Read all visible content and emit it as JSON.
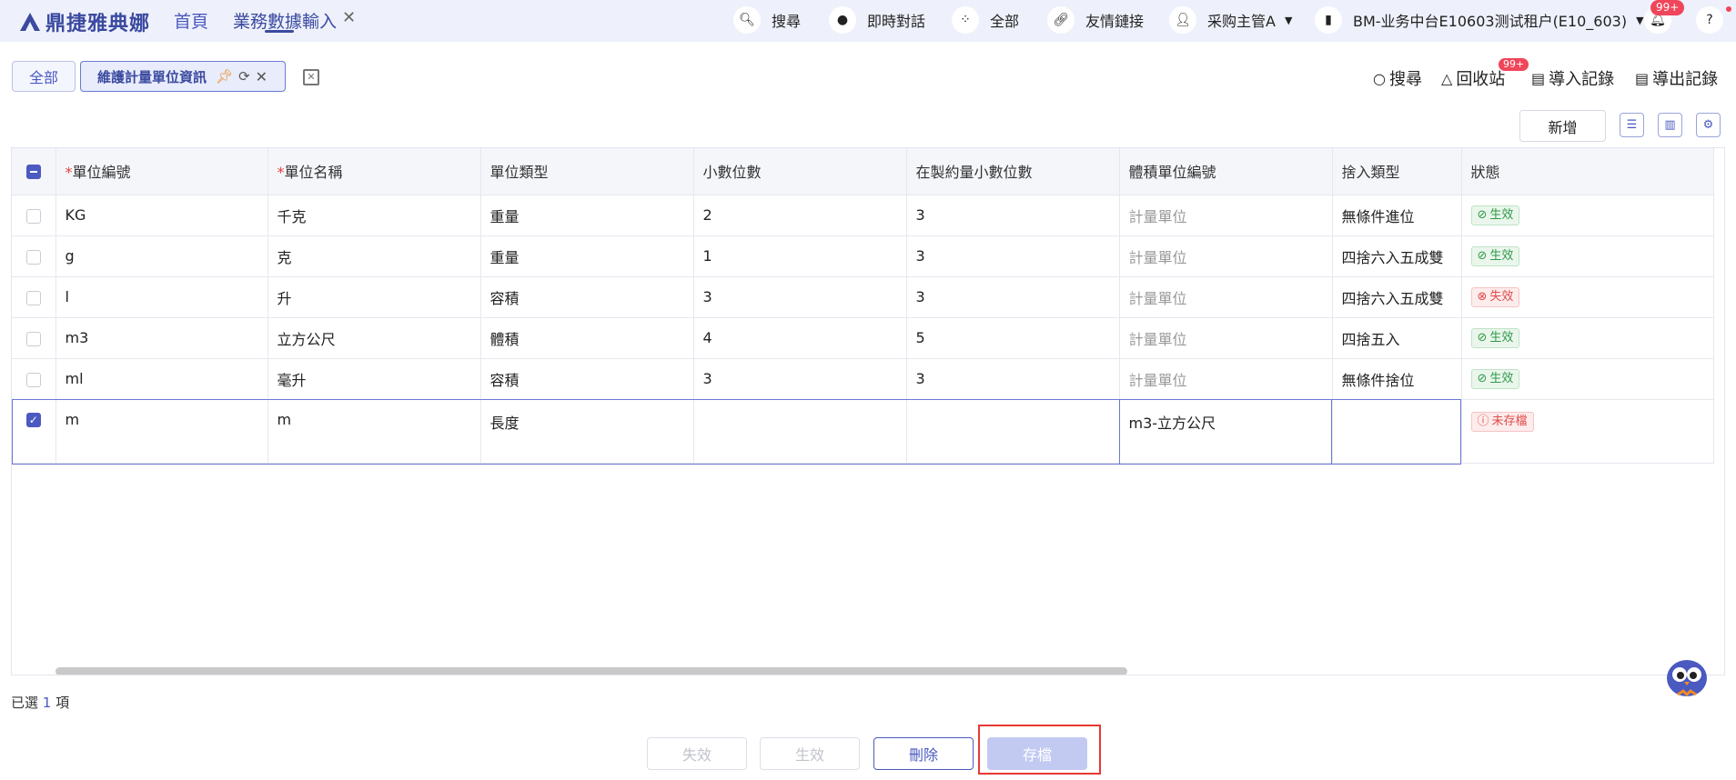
{
  "topbar": {
    "brand": "鼎捷雅典娜",
    "nav": [
      {
        "label": "首頁"
      },
      {
        "label": "業務數據輸入"
      }
    ],
    "tools": [
      {
        "icon": "search-icon",
        "label": "搜尋"
      },
      {
        "icon": "chat-icon",
        "label": "即時對話"
      },
      {
        "icon": "apps-icon",
        "label": "全部"
      },
      {
        "icon": "link-icon",
        "label": "友情鏈接"
      },
      {
        "icon": "user-icon",
        "label": "采购主管A"
      },
      {
        "icon": "tenant-icon",
        "label": "BM-业务中台E10603测试租户(E10_603)"
      }
    ],
    "notification_badge": "99+"
  },
  "tabs": {
    "all": "全部",
    "active": "維護計量單位資訊"
  },
  "right_tools": {
    "search": "搜尋",
    "recycle": "回收站",
    "recycle_badge": "99+",
    "import": "導入記錄",
    "export": "導出記錄"
  },
  "toolbar": {
    "new_label": "新增"
  },
  "table": {
    "columns": [
      "單位編號",
      "單位名稱",
      "單位類型",
      "小數位數",
      "在製約量小數位數",
      "體積單位編號",
      "捨入類型",
      "狀態"
    ],
    "rows": [
      {
        "code": "KG",
        "name": "千克",
        "type": "重量",
        "decimals": "2",
        "wip_decimals": "3",
        "volume_unit": "計量單位",
        "rounding": "無條件進位",
        "status": "生效"
      },
      {
        "code": "g",
        "name": "克",
        "type": "重量",
        "decimals": "1",
        "wip_decimals": "3",
        "volume_unit": "計量單位",
        "rounding": "四捨六入五成雙",
        "status": "生效"
      },
      {
        "code": "l",
        "name": "升",
        "type": "容積",
        "decimals": "3",
        "wip_decimals": "3",
        "volume_unit": "計量單位",
        "rounding": "四捨六入五成雙",
        "status": "失效"
      },
      {
        "code": "m3",
        "name": "立方公尺",
        "type": "體積",
        "decimals": "4",
        "wip_decimals": "5",
        "volume_unit": "計量單位",
        "rounding": "四捨五入",
        "status": "生效"
      },
      {
        "code": "ml",
        "name": "毫升",
        "type": "容積",
        "decimals": "3",
        "wip_decimals": "3",
        "volume_unit": "計量單位",
        "rounding": "無條件捨位",
        "status": "生效"
      },
      {
        "code": "m",
        "name": "m",
        "type": "長度",
        "decimals": "",
        "wip_decimals": "",
        "volume_unit": "m3-立方公尺",
        "rounding": "",
        "status": "未存檔"
      }
    ]
  },
  "footer": {
    "selected_prefix": "已選",
    "selected_count": "1",
    "selected_suffix": "項",
    "buttons": {
      "invalidate": "失效",
      "validate": "生效",
      "delete": "刪除",
      "save": "存檔"
    }
  },
  "colors": {
    "accent": "#4a5ac0",
    "topbar_bg": "#eef1fb",
    "status_ok": "#2e9a48",
    "status_bad": "#e24848",
    "highlight": "#e53935"
  }
}
